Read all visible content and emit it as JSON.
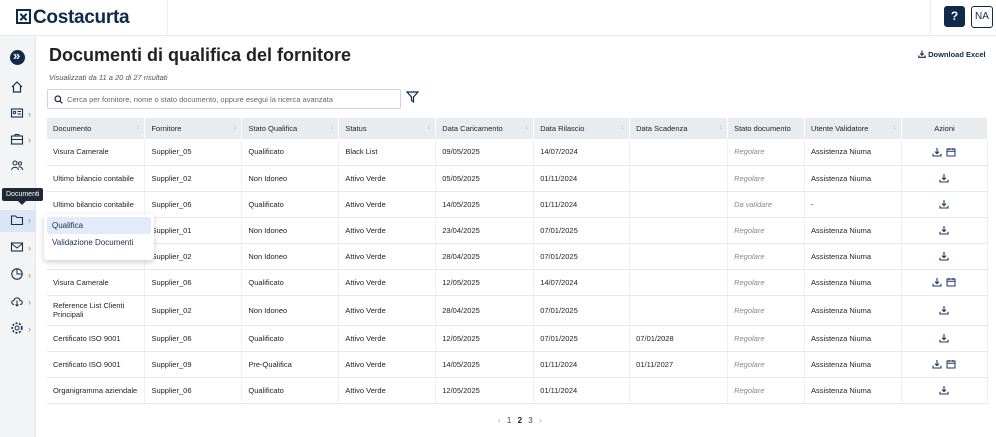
{
  "app": {
    "brand": "Costacurta",
    "help_label": "?",
    "user_initials": "NA"
  },
  "sidebar": {
    "tooltip": "Documenti",
    "submenu": [
      {
        "label": "Qualifica"
      },
      {
        "label": "Validazione Documenti"
      }
    ]
  },
  "page": {
    "title": "Documenti di qualifica del fornitore",
    "subtitle": "Visualizzati da 11 a 20 di 27 risultati",
    "download_label": "Download Excel",
    "search_placeholder": "Cerca per fornitore, nome o stato documento, oppure esegui la ricerca avanzata"
  },
  "table": {
    "headers": [
      "Documento",
      "Fornitore",
      "Stato Qualifica",
      "Status",
      "Data Caricamento",
      "Data Rilascio",
      "Data Scadenza",
      "Stato documento",
      "Utente Validatore",
      "Azioni"
    ],
    "rows": [
      {
        "documento": "Visura Camerale",
        "fornitore": "Supplier_05",
        "stato_qualifica": "Qualificato",
        "status": "Black List",
        "caricamento": "09/05/2025",
        "rilascio": "14/07/2024",
        "scadenza": "",
        "stato_doc": "Regolare",
        "validatore": "Assistenza Niuma",
        "calendar": true
      },
      {
        "documento": "Ultimo bilancio contabile",
        "fornitore": "Supplier_02",
        "stato_qualifica": "Non Idoneo",
        "status": "Attivo Verde",
        "caricamento": "05/05/2025",
        "rilascio": "01/11/2024",
        "scadenza": "",
        "stato_doc": "Regolare",
        "validatore": "Assistenza Niuma",
        "calendar": false
      },
      {
        "documento": "Ultimo bilancio contabile",
        "fornitore": "Supplier_06",
        "stato_qualifica": "Qualificato",
        "status": "Attivo Verde",
        "caricamento": "14/05/2025",
        "rilascio": "01/11/2024",
        "scadenza": "",
        "stato_doc": "Da validare",
        "validatore": "-",
        "calendar": false
      },
      {
        "documento": "",
        "fornitore": "Supplier_01",
        "stato_qualifica": "Non Idoneo",
        "status": "Attivo Verde",
        "caricamento": "23/04/2025",
        "rilascio": "07/01/2025",
        "scadenza": "",
        "stato_doc": "Regolare",
        "validatore": "Assistenza Niuma",
        "calendar": false
      },
      {
        "documento": "",
        "fornitore": "Supplier_02",
        "stato_qualifica": "Non Idoneo",
        "status": "Attivo Verde",
        "caricamento": "28/04/2025",
        "rilascio": "07/01/2025",
        "scadenza": "",
        "stato_doc": "Regolare",
        "validatore": "Assistenza Niuma",
        "calendar": false
      },
      {
        "documento": "Visura Camerale",
        "fornitore": "Supplier_06",
        "stato_qualifica": "Qualificato",
        "status": "Attivo Verde",
        "caricamento": "12/05/2025",
        "rilascio": "14/07/2024",
        "scadenza": "",
        "stato_doc": "Regolare",
        "validatore": "Assistenza Niuma",
        "calendar": true
      },
      {
        "documento": "Reference List Clienti Principali",
        "fornitore": "Supplier_02",
        "stato_qualifica": "Non Idoneo",
        "status": "Attivo Verde",
        "caricamento": "28/04/2025",
        "rilascio": "07/01/2025",
        "scadenza": "",
        "stato_doc": "Regolare",
        "validatore": "Assistenza Niuma",
        "calendar": false,
        "tall": true
      },
      {
        "documento": "Certificato ISO 9001",
        "fornitore": "Supplier_06",
        "stato_qualifica": "Qualificato",
        "status": "Attivo Verde",
        "caricamento": "12/05/2025",
        "rilascio": "07/01/2025",
        "scadenza": "07/01/2028",
        "stato_doc": "Regolare",
        "validatore": "Assistenza Niuma",
        "calendar": false
      },
      {
        "documento": "Certificato ISO 9001",
        "fornitore": "Supplier_09",
        "stato_qualifica": "Pre-Qualifica",
        "status": "Attivo Verde",
        "caricamento": "14/05/2025",
        "rilascio": "01/11/2024",
        "scadenza": "01/11/2027",
        "stato_doc": "Regolare",
        "validatore": "Assistenza Niuma",
        "calendar": true
      },
      {
        "documento": "Organigramma aziendale",
        "fornitore": "Supplier_06",
        "stato_qualifica": "Qualificato",
        "status": "Attivo Verde",
        "caricamento": "12/05/2025",
        "rilascio": "01/11/2024",
        "scadenza": "",
        "stato_doc": "Regolare",
        "validatore": "Assistenza Niuma",
        "calendar": false
      }
    ]
  },
  "pagination": {
    "pages": [
      "1",
      "2",
      "3"
    ],
    "current": "2"
  }
}
